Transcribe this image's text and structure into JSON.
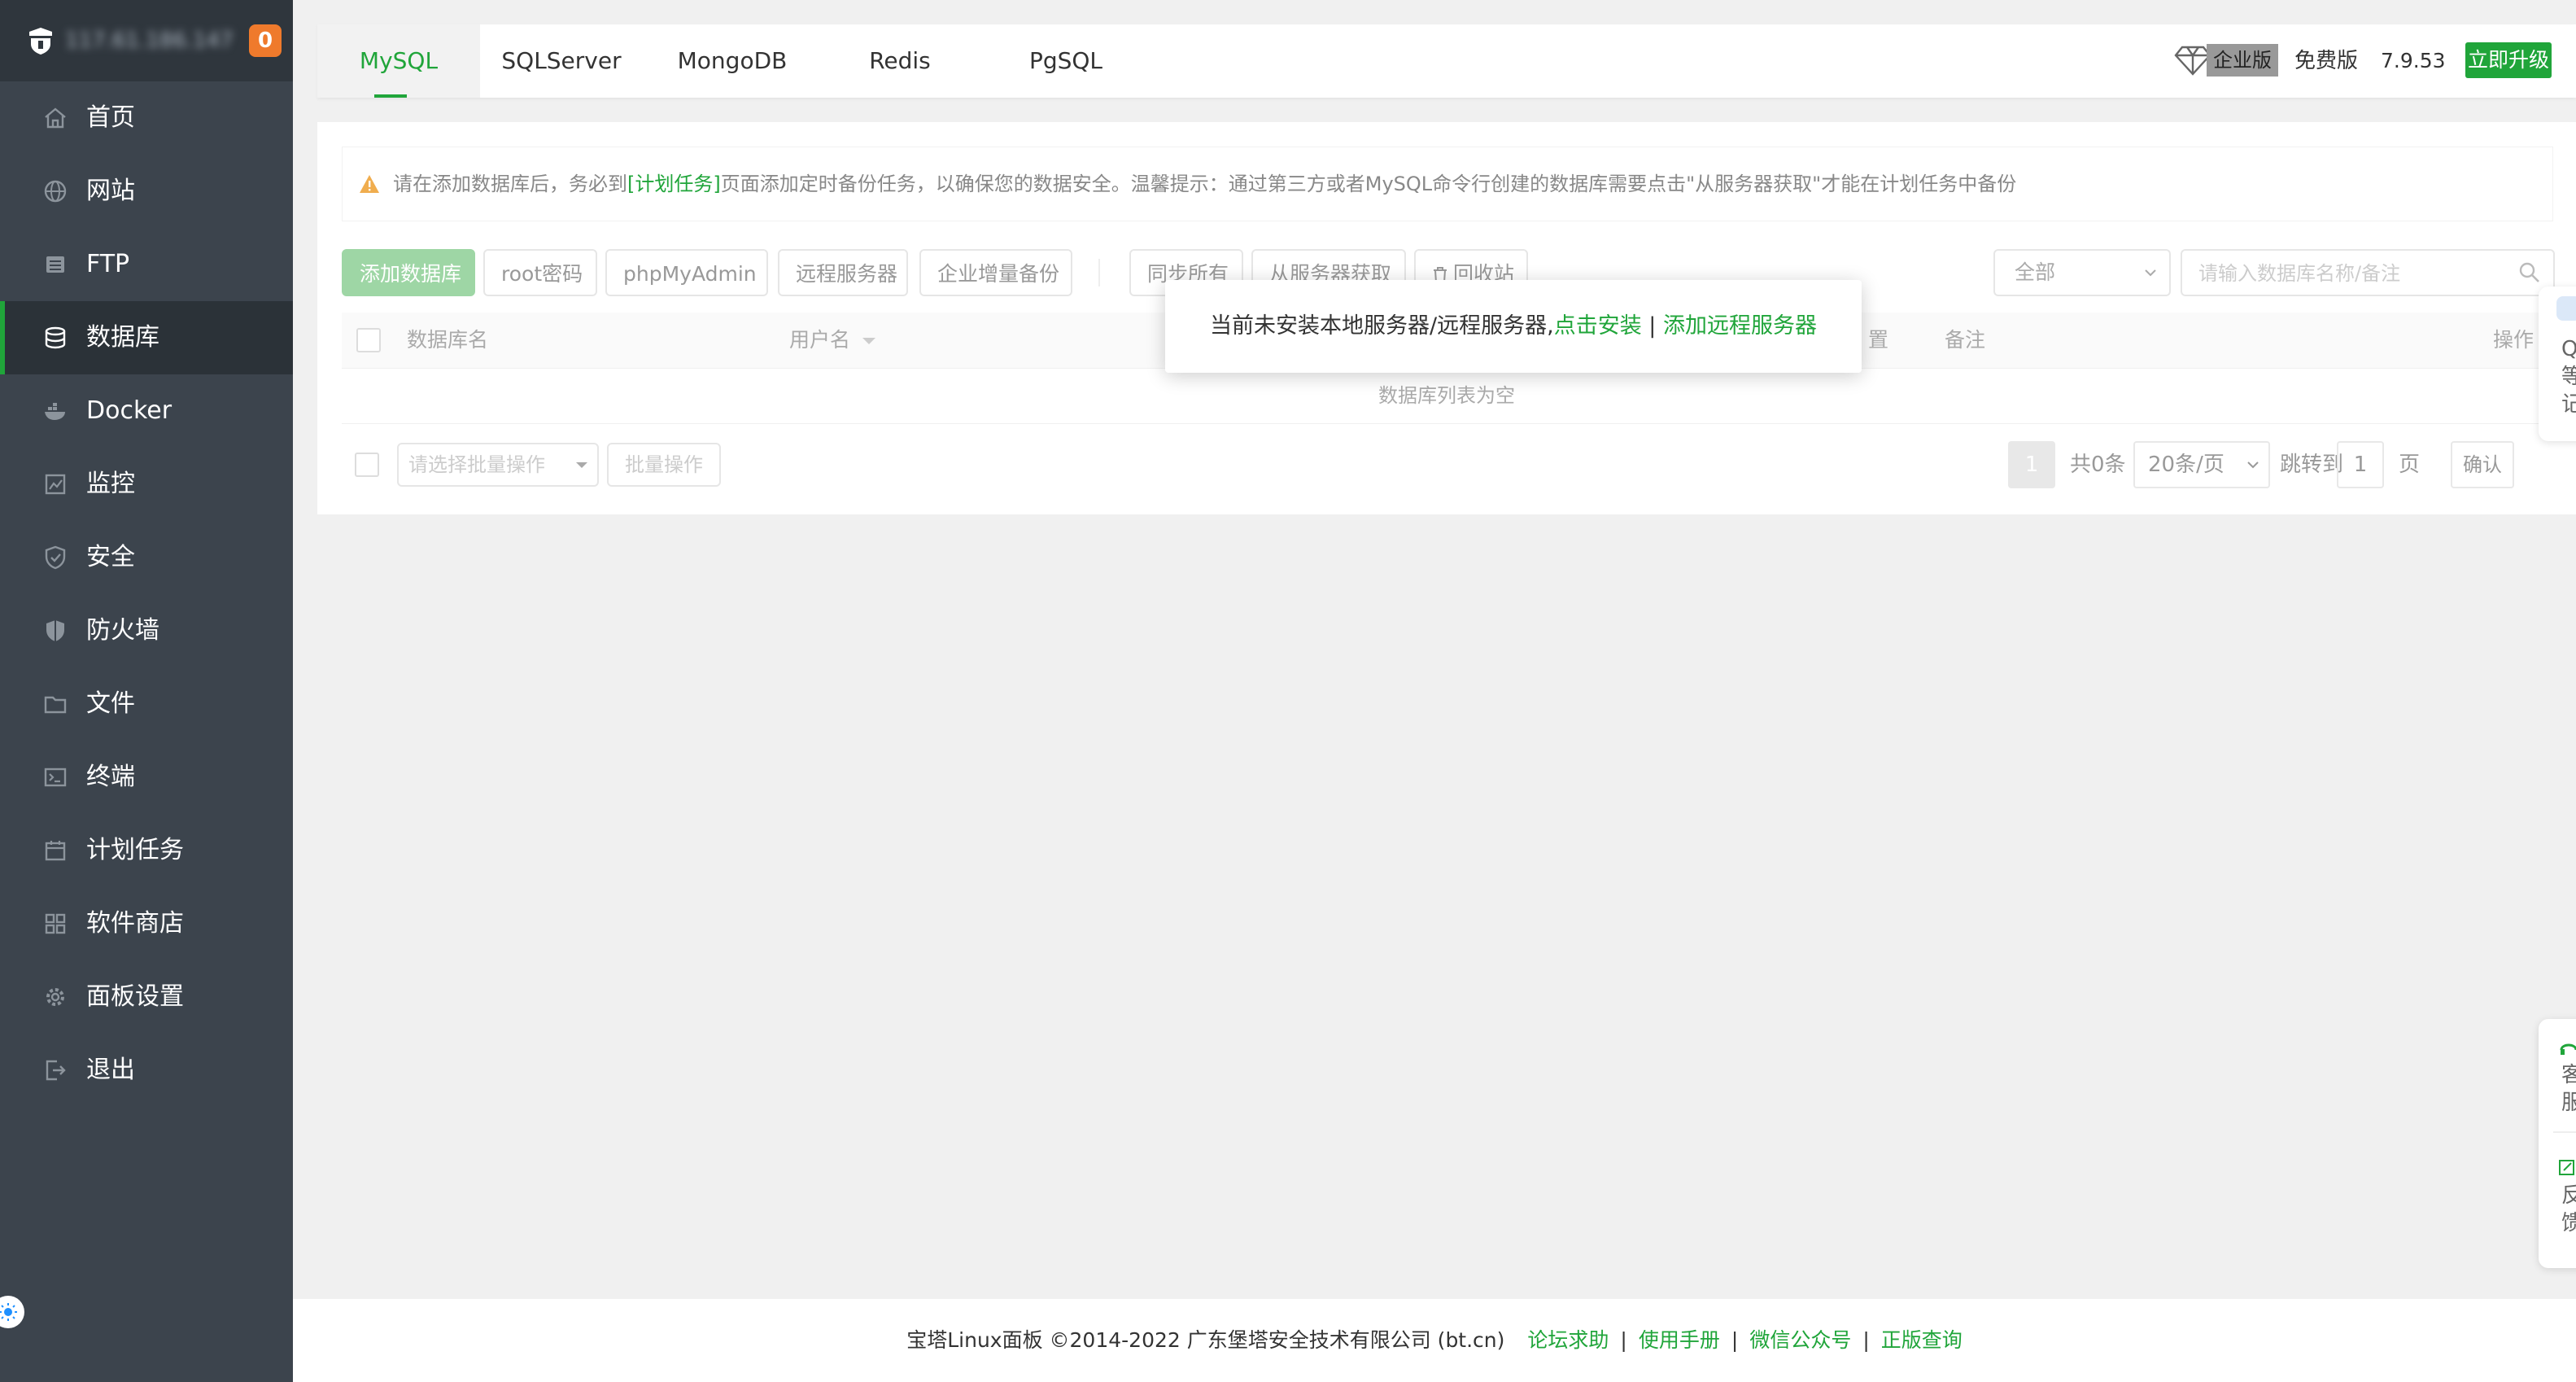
{
  "sidebar": {
    "server_ip": "117.61.186.147",
    "badge_count": "0",
    "items": [
      {
        "label": "首页",
        "icon": "home-icon"
      },
      {
        "label": "网站",
        "icon": "globe-icon"
      },
      {
        "label": "FTP",
        "icon": "ftp-icon"
      },
      {
        "label": "数据库",
        "icon": "database-icon",
        "active": true
      },
      {
        "label": "Docker",
        "icon": "docker-icon"
      },
      {
        "label": "监控",
        "icon": "monitor-icon"
      },
      {
        "label": "安全",
        "icon": "shield-icon"
      },
      {
        "label": "防火墙",
        "icon": "firewall-icon"
      },
      {
        "label": "文件",
        "icon": "folder-icon"
      },
      {
        "label": "终端",
        "icon": "terminal-icon"
      },
      {
        "label": "计划任务",
        "icon": "calendar-icon"
      },
      {
        "label": "软件商店",
        "icon": "app-store-icon"
      },
      {
        "label": "面板设置",
        "icon": "gear-icon"
      },
      {
        "label": "退出",
        "icon": "logout-icon"
      }
    ]
  },
  "tabs": [
    "MySQL",
    "SQLServer",
    "MongoDB",
    "Redis",
    "PgSQL"
  ],
  "version": {
    "enterprise": "企业版",
    "edition": "免费版",
    "number": "7.9.53",
    "upgrade": "立即升级"
  },
  "alert": {
    "prefix": "请在添加数据库后，务必到",
    "link": "[计划任务]",
    "suffix": "页面添加定时备份任务，以确保您的数据安全。温馨提示：通过第三方或者MySQL命令行创建的数据库需要点击\"从服务器获取\"才能在计划任务中备份"
  },
  "toolbar": {
    "add_db": "添加数据库",
    "root_pwd": "root密码",
    "phpmyadmin": "phpMyAdmin",
    "remote_server": "远程服务器",
    "incremental_backup": "企业增量备份",
    "sync_all": "同步所有",
    "fetch_from_server": "从服务器获取",
    "recycle_bin": "回收站"
  },
  "filter": {
    "type_selected": "全部",
    "search_placeholder": "请输入数据库名称/备注"
  },
  "table": {
    "headers": {
      "name": "数据库名",
      "user": "用户名",
      "position": "置",
      "note": "备注",
      "action": "操作"
    },
    "empty": "数据库列表为空"
  },
  "batch": {
    "placeholder": "请选择批量操作",
    "button": "批量操作"
  },
  "pagination": {
    "current": "1",
    "total": "共0条",
    "page_size": "20条/页",
    "jump_label": "跳转到",
    "jump_value": "1",
    "page_unit": "页",
    "confirm": "确认"
  },
  "popup": {
    "text": "当前未安装本地服务器/远程服务器,",
    "install": "点击安装",
    "separator": " | ",
    "add_remote": "添加远程服务器"
  },
  "float": {
    "top_text": "Q 等 记",
    "bottom_text_1": "客 服",
    "bottom_text_2": "反 馈"
  },
  "footer": {
    "copyright": "宝塔Linux面板 ©2014-2022 广东堡塔安全技术有限公司 (bt.cn)",
    "links": [
      "论坛求助",
      "使用手册",
      "微信公众号",
      "正版查询"
    ]
  },
  "colors": {
    "brand_green": "#20a53a",
    "sidebar_bg": "#3c444d",
    "badge_orange": "#ef7a2c"
  }
}
